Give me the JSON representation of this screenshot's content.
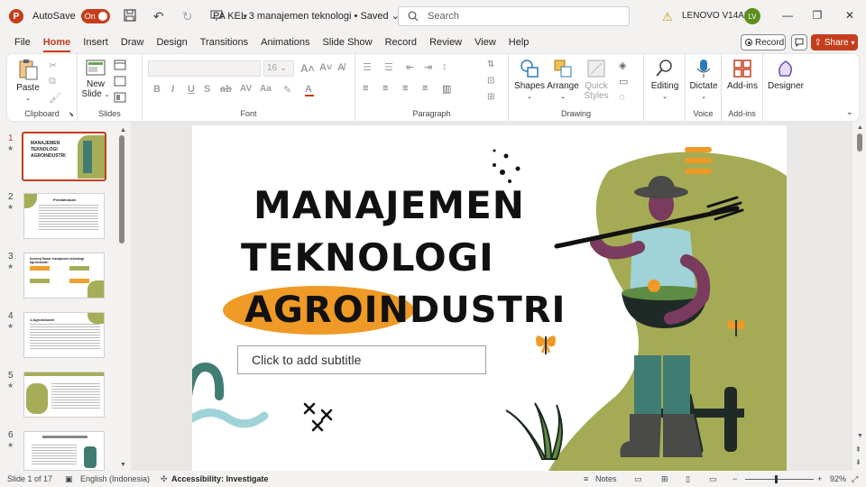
{
  "titlebar": {
    "autosave_label": "AutoSave",
    "autosave_state": "On",
    "document_title": "PA KEL 3 manajemen teknologi • Saved",
    "search_placeholder": "Search",
    "device_name": "LENOVO V14ADA",
    "user_initials": "LV"
  },
  "menu": {
    "items": [
      "File",
      "Home",
      "Insert",
      "Draw",
      "Design",
      "Transitions",
      "Animations",
      "Slide Show",
      "Record",
      "Review",
      "View",
      "Help"
    ],
    "active": "Home",
    "record_label": "Record",
    "share_label": "Share"
  },
  "ribbon": {
    "clipboard": {
      "label": "Clipboard",
      "paste": "Paste"
    },
    "slides": {
      "label": "Slides",
      "new_slide_line1": "New",
      "new_slide_line2": "Slide"
    },
    "font": {
      "label": "Font",
      "size": "16"
    },
    "paragraph": {
      "label": "Paragraph"
    },
    "drawing": {
      "label": "Drawing",
      "shapes": "Shapes",
      "arrange": "Arrange",
      "quick_styles_line1": "Quick",
      "quick_styles_line2": "Styles"
    },
    "editing": {
      "label": "Editing"
    },
    "voice": {
      "label": "Voice",
      "dictate": "Dictate"
    },
    "addins": {
      "label": "Add-ins",
      "addins_btn": "Add-ins"
    },
    "designer": {
      "label": "Designer"
    }
  },
  "thumbnails": [
    {
      "num": "1",
      "title": "MANAJEMEN TEKNOLOGI AGROINDUSTRI"
    },
    {
      "num": "2",
      "title": "Pendahuluan"
    },
    {
      "num": "3",
      "title": "Konsep Dasar manajemen teknologi agroindustri"
    },
    {
      "num": "4",
      "title": "1.Agroindustri"
    },
    {
      "num": "5",
      "title": ""
    },
    {
      "num": "6",
      "title": ""
    }
  ],
  "slide": {
    "title_line1": "MANAJEMEN",
    "title_line2": "TEKNOLOGI",
    "title_line3": "AGROINDUSTRI",
    "subtitle_placeholder": "Click to add subtitle"
  },
  "status": {
    "slide_counter": "Slide 1 of 17",
    "language": "English (Indonesia)",
    "accessibility": "Accessibility: Investigate",
    "notes": "Notes",
    "zoom": "92%"
  }
}
